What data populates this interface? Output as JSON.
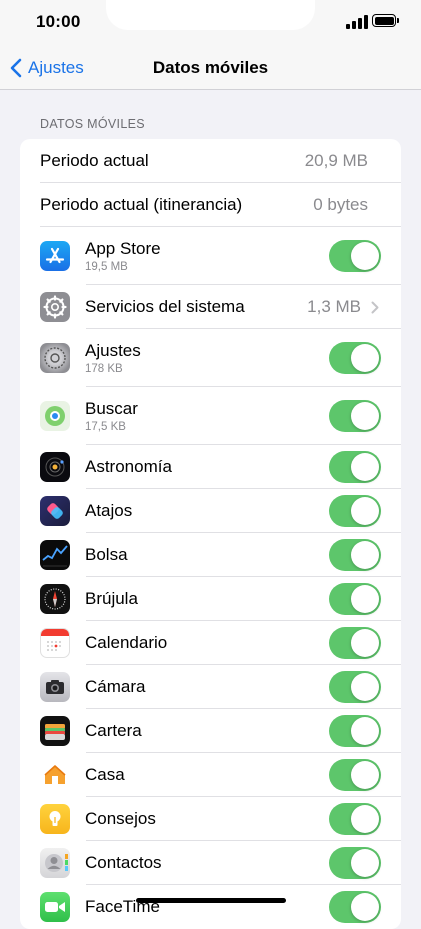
{
  "status": {
    "time": "10:00"
  },
  "nav": {
    "back_label": "Ajustes",
    "title": "Datos móviles"
  },
  "section": {
    "header": "DATOS MÓVILES"
  },
  "usage": [
    {
      "label": "Periodo actual",
      "value": "20,9 MB"
    },
    {
      "label": "Periodo actual (itinerancia)",
      "value": "0 bytes"
    }
  ],
  "apps": [
    {
      "name": "App Store",
      "sub": "19,5 MB",
      "enabled": true
    },
    {
      "name": "Servicios del sistema",
      "value": "1,3 MB"
    },
    {
      "name": "Ajustes",
      "sub": "178 KB",
      "enabled": true
    },
    {
      "name": "Buscar",
      "sub": "17,5 KB",
      "enabled": true
    },
    {
      "name": "Astronomía",
      "enabled": true
    },
    {
      "name": "Atajos",
      "enabled": true
    },
    {
      "name": "Bolsa",
      "enabled": true
    },
    {
      "name": "Brújula",
      "enabled": true
    },
    {
      "name": "Calendario",
      "enabled": true
    },
    {
      "name": "Cámara",
      "enabled": true
    },
    {
      "name": "Cartera",
      "enabled": true
    },
    {
      "name": "Casa",
      "enabled": true
    },
    {
      "name": "Consejos",
      "enabled": true
    },
    {
      "name": "Contactos",
      "enabled": true
    },
    {
      "name": "FaceTime",
      "enabled": true
    }
  ],
  "colors": {
    "accent": "#1a73e8",
    "toggle_on": "#5dc66b",
    "background": "#f2f2f7"
  }
}
